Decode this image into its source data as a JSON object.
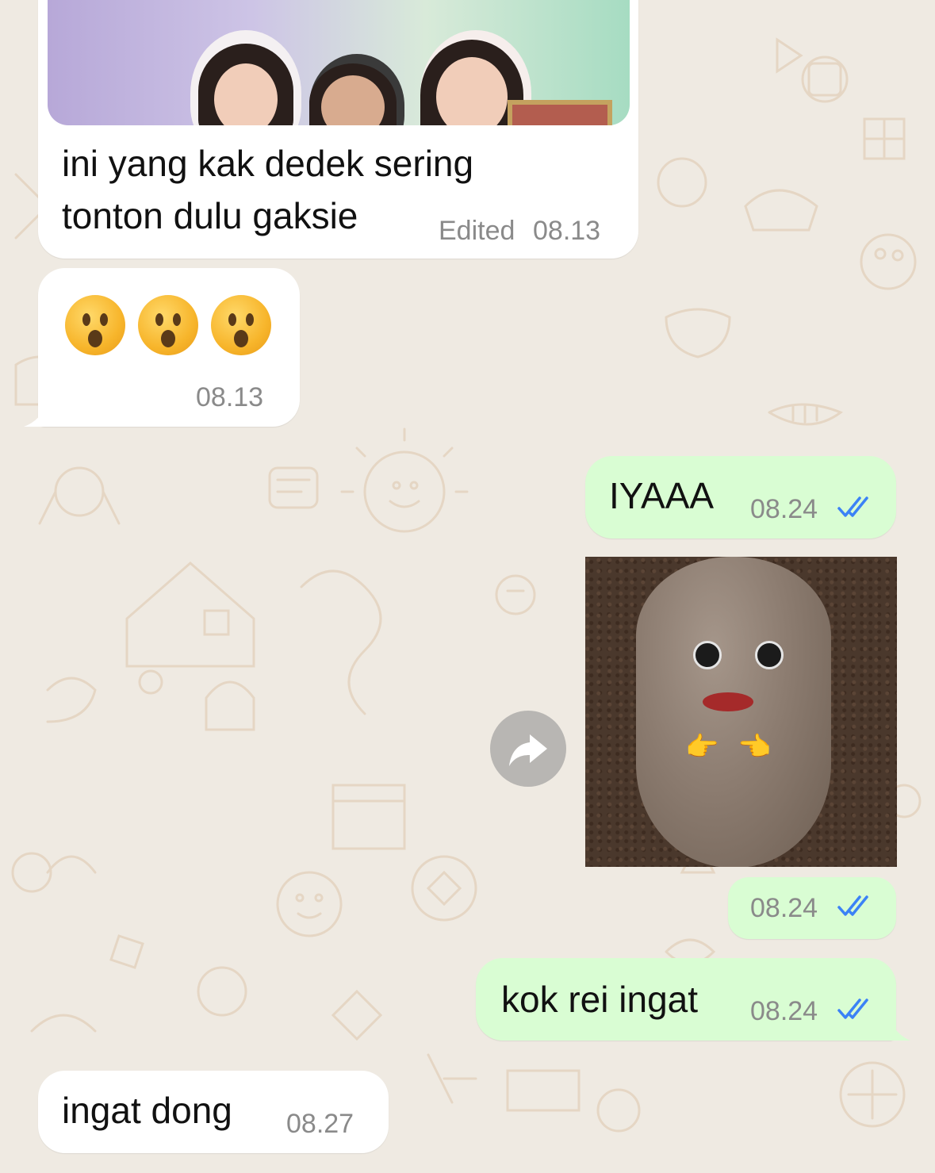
{
  "chat": {
    "messages": [
      {
        "direction": "incoming",
        "type": "photo-caption",
        "text_line1": "ini yang kak dedek sering",
        "text_line2": "tonton dulu gaksie",
        "status": "Edited",
        "time": "08.13"
      },
      {
        "direction": "incoming",
        "type": "emoji",
        "emojis": [
          "hushed-face",
          "hushed-face",
          "hushed-face"
        ],
        "time": "08.13"
      },
      {
        "direction": "outgoing",
        "type": "text",
        "text": "IYAAA",
        "time": "08.24",
        "read": true
      },
      {
        "direction": "outgoing",
        "type": "sticker",
        "sticker": "potato-face",
        "time": "08.24",
        "read": true
      },
      {
        "direction": "outgoing",
        "type": "text",
        "text": "kok rei ingat",
        "time": "08.24",
        "read": true
      },
      {
        "direction": "incoming",
        "type": "text",
        "text": "ingat dong",
        "time": "08.27"
      }
    ]
  },
  "colors": {
    "background": "#efeae2",
    "incoming_bubble": "#ffffff",
    "outgoing_bubble": "#d9fdd3",
    "read_tick": "#3b82f6",
    "timestamp": "#8a8a8a"
  },
  "icons": {
    "read_receipt": "double-check-icon",
    "forward": "forward-arrow-icon"
  }
}
